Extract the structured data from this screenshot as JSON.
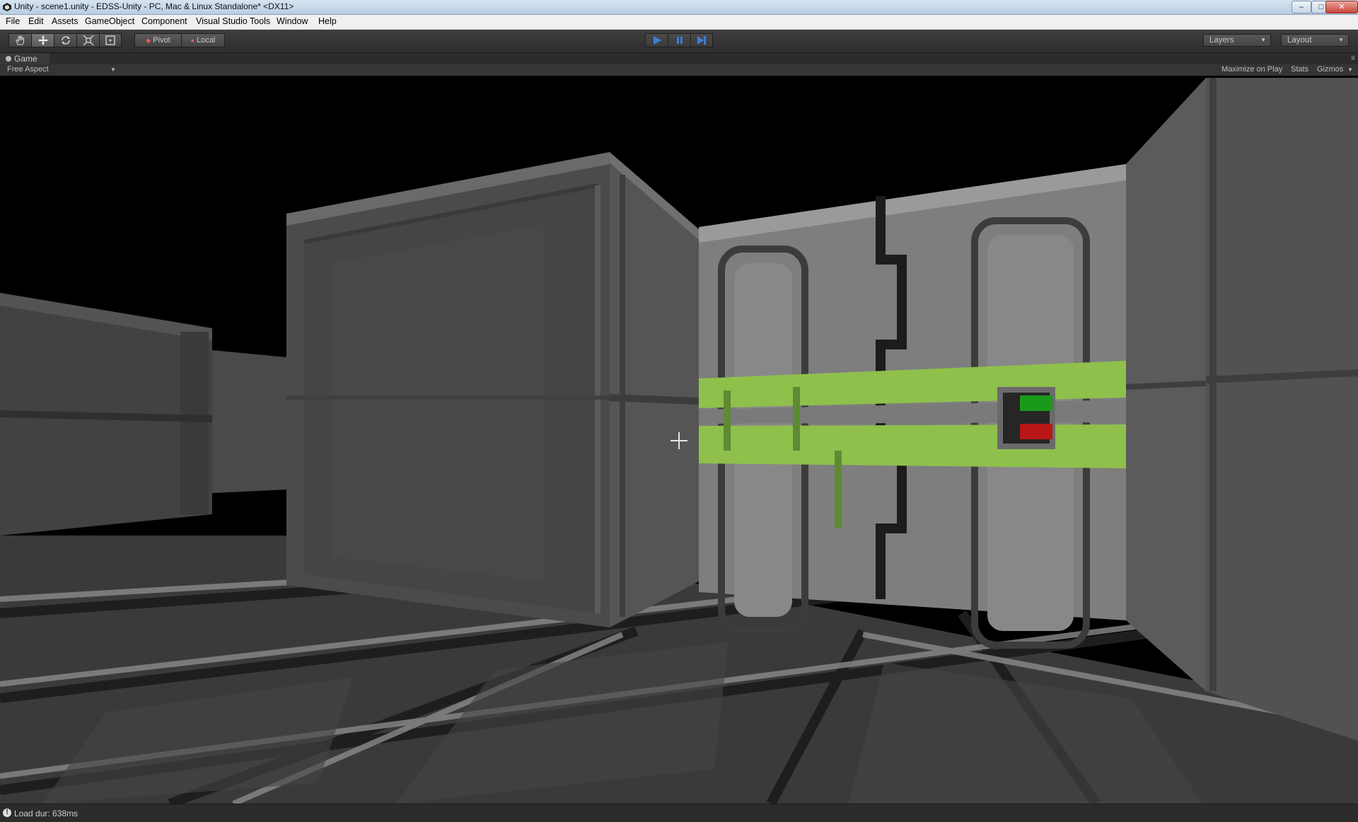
{
  "window": {
    "title": "Unity - scene1.unity - EDSS-Unity - PC, Mac & Linux Standalone* <DX11>",
    "controls": {
      "minimize": "–",
      "maximize": "□",
      "close": "✕"
    }
  },
  "menu": {
    "items": [
      "File",
      "Edit",
      "Assets",
      "GameObject",
      "Component",
      "Visual Studio Tools",
      "Window",
      "Help"
    ]
  },
  "toolbar": {
    "tools": [
      "hand-icon",
      "move-icon",
      "rotate-icon",
      "scale-icon",
      "rect-icon"
    ],
    "pivot_label": "Pivot",
    "local_label": "Local",
    "layers_label": "Layers",
    "layout_label": "Layout"
  },
  "game_view": {
    "tab_label": "Game",
    "aspect_label": "Free Aspect",
    "maximize_label": "Maximize on Play",
    "stats_label": "Stats",
    "gizmos_label": "Gizmos"
  },
  "status": {
    "message": "Load dur: 638ms"
  },
  "colors": {
    "door_light_green": "#8fc04c",
    "door_status_green": "#1a9a1a",
    "door_status_red": "#b81616",
    "play_blue": "#3d7fd6"
  }
}
